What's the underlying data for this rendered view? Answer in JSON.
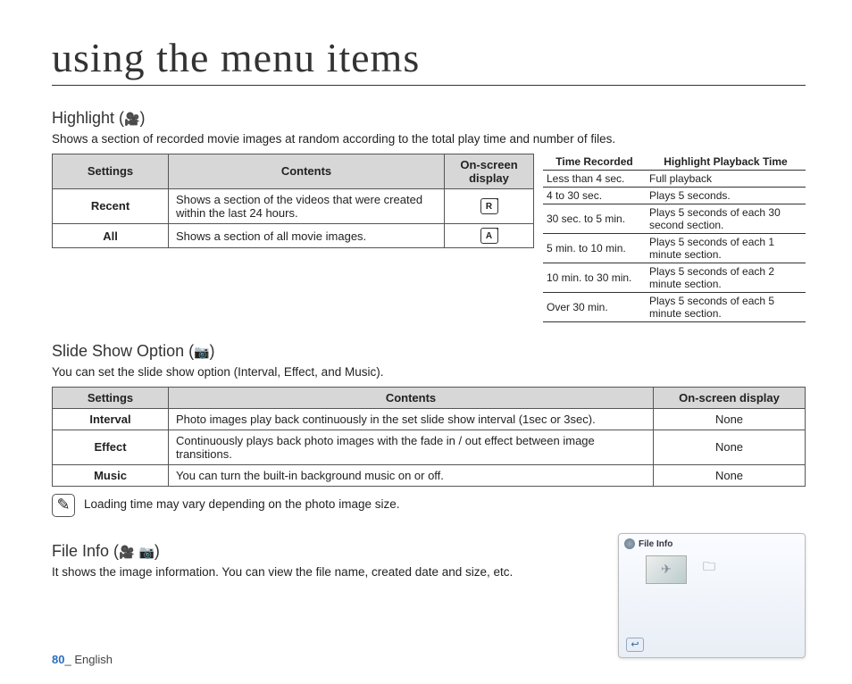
{
  "page_title": "using the menu items",
  "highlight": {
    "heading": "Highlight (",
    "heading_close": ")",
    "icon": "🎥",
    "desc": "Shows a section of recorded movie images at random according to the total play time and number of files.",
    "table": {
      "headers": [
        "Settings",
        "Contents",
        "On-screen display"
      ],
      "rows": [
        {
          "setting": "Recent",
          "content": "Shows a section of the videos that were created within the last 24 hours.",
          "icon": "R"
        },
        {
          "setting": "All",
          "content": "Shows a section of all movie images.",
          "icon": "A"
        }
      ]
    },
    "time_table": {
      "headers": [
        "Time Recorded",
        "Highlight Playback Time"
      ],
      "rows": [
        {
          "tr": "Less than 4 sec.",
          "pb": "Full playback"
        },
        {
          "tr": "4 to 30 sec.",
          "pb": "Plays 5 seconds."
        },
        {
          "tr": "30 sec. to 5 min.",
          "pb": "Plays 5 seconds of each 30 second section."
        },
        {
          "tr": "5 min. to 10 min.",
          "pb": "Plays 5 seconds of each 1 minute section."
        },
        {
          "tr": "10 min. to 30 min.",
          "pb": "Plays 5 seconds of each 2 minute section."
        },
        {
          "tr": "Over 30 min.",
          "pb": "Plays 5 seconds of each 5 minute section."
        }
      ]
    }
  },
  "slideshow": {
    "heading": "Slide Show Option (",
    "heading_close": ")",
    "icon": "📷",
    "desc": "You can set the slide show option (Interval, Effect, and Music).",
    "table": {
      "headers": [
        "Settings",
        "Contents",
        "On-screen display"
      ],
      "rows": [
        {
          "setting": "Interval",
          "content": "Photo images play back continuously in the set slide show interval (1sec or 3sec).",
          "osd": "None"
        },
        {
          "setting": "Effect",
          "content": "Continuously plays back photo images with the fade in / out effect between image transitions.",
          "osd": "None"
        },
        {
          "setting": "Music",
          "content": "You can turn the built-in background music on or off.",
          "osd": "None"
        }
      ]
    }
  },
  "note": {
    "text": "Loading time may vary depending on the photo image size."
  },
  "fileinfo": {
    "heading": "File Info (",
    "heading_close": ")",
    "icon_movie": "🎥",
    "icon_photo": "📷",
    "desc": "It shows the image information. You can view the file name, created date and size, etc.",
    "screenshot_label": "File Info"
  },
  "footer": {
    "page": "80",
    "sep": "_ ",
    "lang": "English"
  }
}
